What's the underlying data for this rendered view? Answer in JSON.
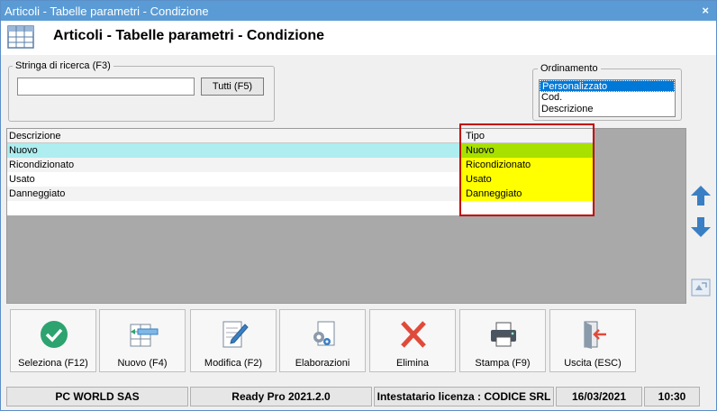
{
  "window": {
    "title": "Articoli - Tabelle parametri - Condizione",
    "close_glyph": "×"
  },
  "header": {
    "title": "Articoli - Tabelle parametri - Condizione"
  },
  "search": {
    "legend": "Stringa di ricerca (F3)",
    "value": "",
    "all_button": "Tutti (F5)"
  },
  "ordering": {
    "legend": "Ordinamento",
    "options": [
      "Personalizzato",
      "Cod.",
      "Descrizione"
    ],
    "selected": "Personalizzato"
  },
  "grid": {
    "columns": [
      "Descrizione",
      "Tipo"
    ],
    "rows": [
      {
        "descrizione": "Nuovo",
        "tipo": "Nuovo"
      },
      {
        "descrizione": "Ricondizionato",
        "tipo": "Ricondizionato"
      },
      {
        "descrizione": "Usato",
        "tipo": "Usato"
      },
      {
        "descrizione": "Danneggiato",
        "tipo": "Danneggiato"
      }
    ]
  },
  "toolbar": {
    "seleziona": "Seleziona (F12)",
    "nuovo": "Nuovo (F4)",
    "modifica": "Modifica (F2)",
    "elaborazioni": "Elaborazioni",
    "elimina": "Elimina",
    "stampa": "Stampa (F9)",
    "uscita": "Uscita (ESC)"
  },
  "status": {
    "company": "PC WORLD SAS",
    "product": "Ready Pro 2021.2.0",
    "license": "Intestatario licenza : CODICE SRL",
    "date": "16/03/2021",
    "time": "10:30"
  },
  "colors": {
    "titlebar": "#5a9bd5",
    "row_selected": "#aeeef0",
    "tipo_green": "#a8e000",
    "tipo_yellow": "#ffff00",
    "highlight_box": "#c00000"
  }
}
